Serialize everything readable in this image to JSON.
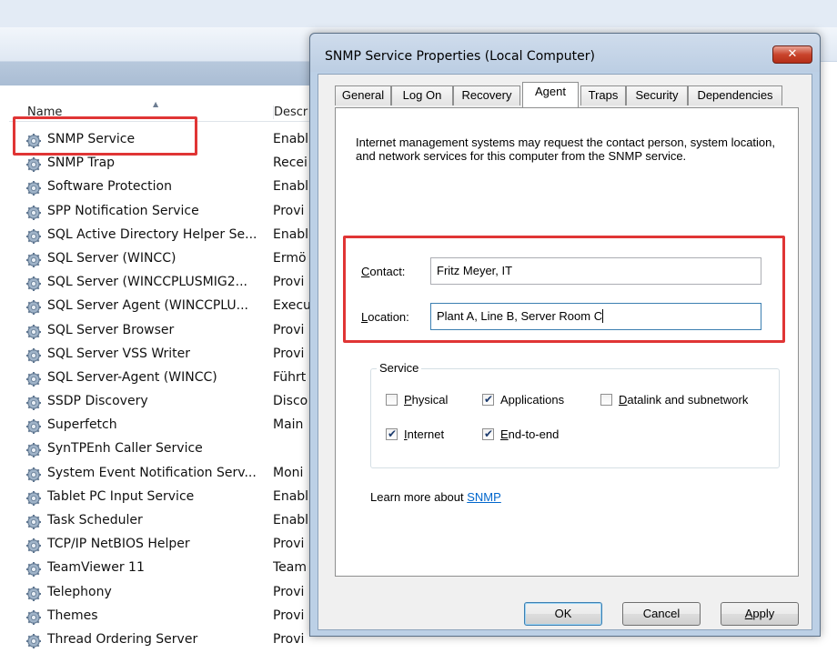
{
  "services_window": {
    "columns": {
      "name": "Name",
      "description": "Descr"
    },
    "rows": [
      {
        "name": "SNMP Service",
        "desc": "Enabl"
      },
      {
        "name": "SNMP Trap",
        "desc": "Recei"
      },
      {
        "name": "Software Protection",
        "desc": "Enabl"
      },
      {
        "name": "SPP Notification Service",
        "desc": "Provi"
      },
      {
        "name": "SQL Active Directory Helper Se...",
        "desc": "Enabl"
      },
      {
        "name": "SQL Server (WINCC)",
        "desc": "Ermö"
      },
      {
        "name": "SQL Server (WINCCPLUSMIG2...",
        "desc": "Provi"
      },
      {
        "name": "SQL Server Agent (WINCCPLU...",
        "desc": "Execu"
      },
      {
        "name": "SQL Server Browser",
        "desc": "Provi"
      },
      {
        "name": "SQL Server VSS Writer",
        "desc": "Provi"
      },
      {
        "name": "SQL Server-Agent (WINCC)",
        "desc": "Führt"
      },
      {
        "name": "SSDP Discovery",
        "desc": "Disco"
      },
      {
        "name": "Superfetch",
        "desc": "Main"
      },
      {
        "name": "SynTPEnh Caller Service",
        "desc": ""
      },
      {
        "name": "System Event Notification Serv...",
        "desc": "Moni"
      },
      {
        "name": "Tablet PC Input Service",
        "desc": "Enabl"
      },
      {
        "name": "Task Scheduler",
        "desc": "Enabl"
      },
      {
        "name": "TCP/IP NetBIOS Helper",
        "desc": "Provi"
      },
      {
        "name": "TeamViewer 11",
        "desc": "Team"
      },
      {
        "name": "Telephony",
        "desc": "Provi"
      },
      {
        "name": "Themes",
        "desc": "Provi"
      },
      {
        "name": "Thread Ordering Server",
        "desc": "Provi"
      }
    ]
  },
  "dialog": {
    "title": "SNMP Service Properties (Local Computer)",
    "close_label": "✕",
    "tabs": [
      "General",
      "Log On",
      "Recovery",
      "Agent",
      "Traps",
      "Security",
      "Dependencies"
    ],
    "active_tab": "Agent",
    "intro": "Internet management systems may request the contact person, system location, and network services for this computer from the SNMP service.",
    "contact_label": "Contact:",
    "contact_value": "Fritz Meyer, IT",
    "location_label": "Location:",
    "location_value": "Plant A, Line B, Server Room C",
    "service_group_label": "Service",
    "services": [
      {
        "label": "Physical",
        "checked": false
      },
      {
        "label": "Applications",
        "checked": true
      },
      {
        "label": "Datalink and subnetwork",
        "checked": false
      },
      {
        "label": "Internet",
        "checked": true
      },
      {
        "label": "End-to-end",
        "checked": true
      }
    ],
    "learn_more_prefix": "Learn more about ",
    "learn_more_link": "SNMP",
    "buttons": {
      "ok": "OK",
      "cancel": "Cancel",
      "apply": "Apply"
    }
  },
  "colors": {
    "highlight": "#e03535",
    "link": "#0066cc"
  }
}
